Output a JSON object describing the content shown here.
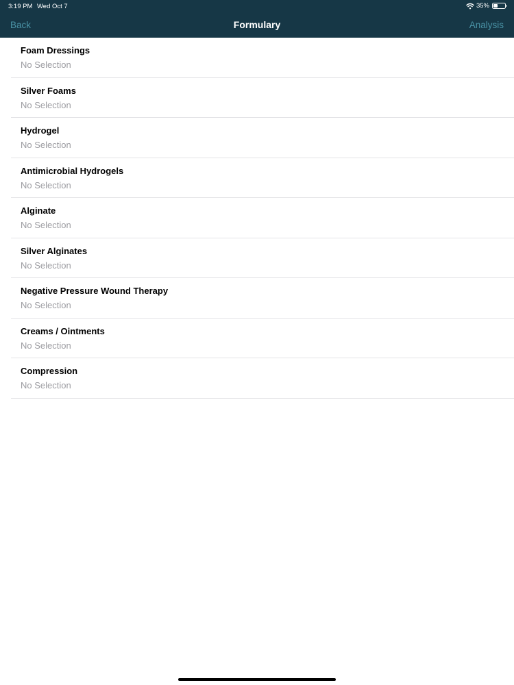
{
  "status_bar": {
    "time": "3:19 PM",
    "date": "Wed Oct 7",
    "battery_text": "35%",
    "battery_level": 0.35
  },
  "nav": {
    "back_label": "Back",
    "title": "Formulary",
    "analysis_label": "Analysis"
  },
  "categories": [
    {
      "name": "Foam Dressings",
      "value": "No Selection"
    },
    {
      "name": "Silver Foams",
      "value": "No Selection"
    },
    {
      "name": "Hydrogel",
      "value": "No Selection"
    },
    {
      "name": "Antimicrobial Hydrogels",
      "value": "No Selection"
    },
    {
      "name": "Alginate",
      "value": "No Selection"
    },
    {
      "name": "Silver Alginates",
      "value": "No Selection"
    },
    {
      "name": "Negative Pressure Wound Therapy",
      "value": "No Selection"
    },
    {
      "name": "Creams / Ointments",
      "value": "No Selection"
    },
    {
      "name": "Compression",
      "value": "No Selection"
    }
  ],
  "colors": {
    "nav_background": "#163746",
    "nav_button": "#4a93a6",
    "secondary_text": "#9b9ba0",
    "separator": "#e3e3e6"
  },
  "icons": [
    "wifi-icon",
    "battery-icon"
  ]
}
